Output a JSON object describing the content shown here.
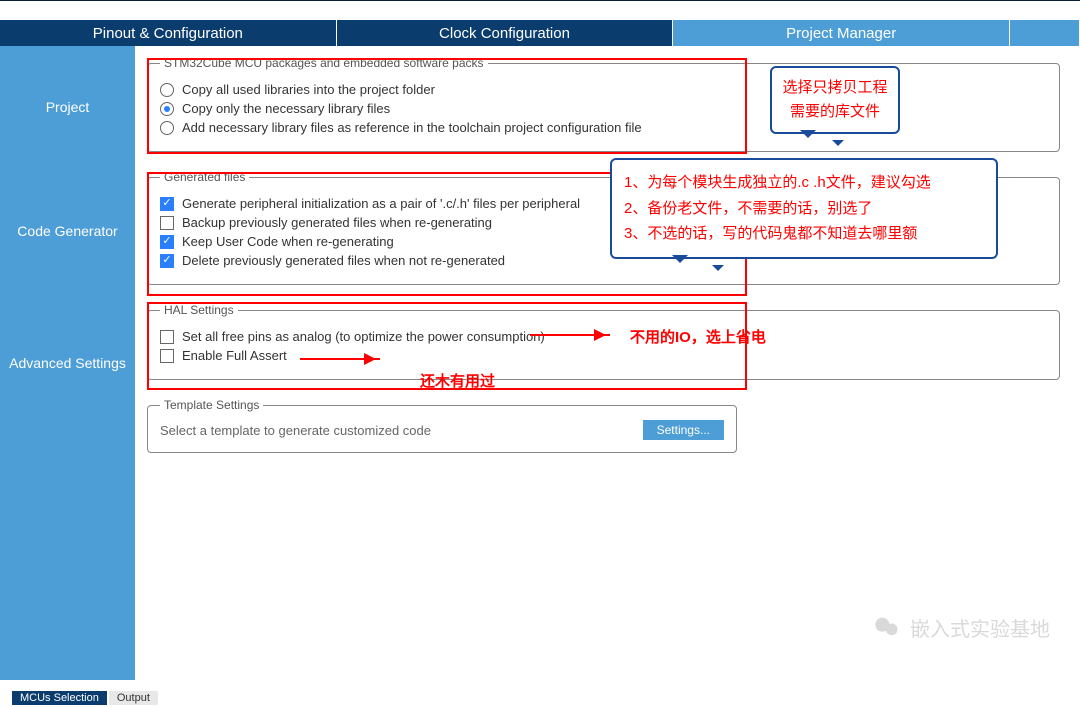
{
  "tabs": {
    "t1": "Pinout & Configuration",
    "t2": "Clock Configuration",
    "t3": "Project Manager"
  },
  "sidebar": {
    "project": "Project",
    "codegen": "Code Generator",
    "advanced": "Advanced Settings"
  },
  "packages": {
    "legend": "STM32Cube MCU packages and embedded software packs",
    "opt1": "Copy all used libraries into the project folder",
    "opt2": "Copy only the necessary library files",
    "opt3": "Add necessary library files as reference in the toolchain project configuration file"
  },
  "generated": {
    "legend": "Generated files",
    "opt1": "Generate peripheral initialization as a pair of '.c/.h' files per peripheral",
    "opt2": "Backup previously generated files when re-generating",
    "opt3": "Keep User Code when re-generating",
    "opt4": "Delete previously generated files when not re-generated"
  },
  "hal": {
    "legend": "HAL Settings",
    "opt1": "Set all free pins as analog (to optimize the power consumption)",
    "opt2": "Enable Full Assert"
  },
  "template": {
    "legend": "Template Settings",
    "text": "Select a template to generate customized code",
    "button": "Settings..."
  },
  "annotations": {
    "callout1_l1": "选择只拷贝工程",
    "callout1_l2": "需要的库文件",
    "callout2_l1": "1、为每个模块生成独立的.c .h文件，建议勾选",
    "callout2_l2": "2、备份老文件，不需要的话，别选了",
    "callout2_l3": "3、不选的话，写的代码鬼都不知道去哪里额",
    "io_note": "不用的IO，选上省电",
    "assert_note": "还木有用过"
  },
  "bottom_tabs": {
    "b1": "MCUs Selection",
    "b2": "Output"
  },
  "watermark": "嵌入式实验基地"
}
